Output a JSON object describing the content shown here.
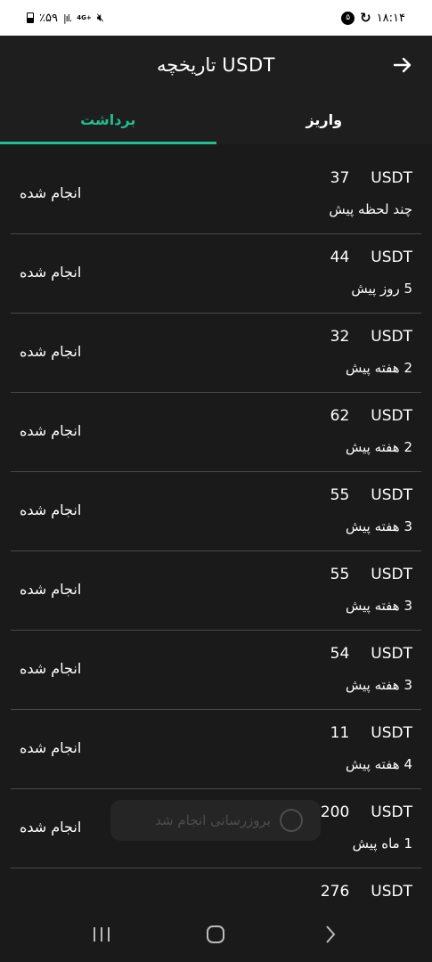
{
  "status_bar": {
    "battery_text": "٪۵۹",
    "signal_text": "|ıl.",
    "network_text": "4G+",
    "mute_icon": "mute-icon",
    "badge_text": "۵",
    "time": "۱۸:۱۴"
  },
  "header": {
    "title": "تاریخچه  USDT",
    "back_icon": "arrow-right-icon"
  },
  "tabs": [
    {
      "label": "برداشت",
      "active": true
    },
    {
      "label": "واریز",
      "active": false
    }
  ],
  "transactions": [
    {
      "currency": "USDT",
      "amount": "37",
      "time": "چند لحظه پیش",
      "status": "انجام شده"
    },
    {
      "currency": "USDT",
      "amount": "44",
      "time": "5 روز پیش",
      "status": "انجام شده"
    },
    {
      "currency": "USDT",
      "amount": "32",
      "time": "2 هفته پیش",
      "status": "انجام شده"
    },
    {
      "currency": "USDT",
      "amount": "62",
      "time": "2 هفته پیش",
      "status": "انجام شده"
    },
    {
      "currency": "USDT",
      "amount": "55",
      "time": "3 هفته پیش",
      "status": "انجام شده"
    },
    {
      "currency": "USDT",
      "amount": "55",
      "time": "3 هفته پیش",
      "status": "انجام شده"
    },
    {
      "currency": "USDT",
      "amount": "54",
      "time": "3 هفته پیش",
      "status": "انجام شده"
    },
    {
      "currency": "USDT",
      "amount": "11",
      "time": "4 هفته پیش",
      "status": "انجام شده"
    },
    {
      "currency": "USDT",
      "amount": "200",
      "time": "1 ماه پیش",
      "status": "انجام شده"
    },
    {
      "currency": "USDT",
      "amount": "276",
      "time": "",
      "status": ""
    }
  ],
  "toast": {
    "text": "بروزرسانی انجام شد"
  },
  "colors": {
    "accent": "#1fbf8f",
    "background": "#1a1a1a",
    "divider": "#4a4a4a"
  }
}
